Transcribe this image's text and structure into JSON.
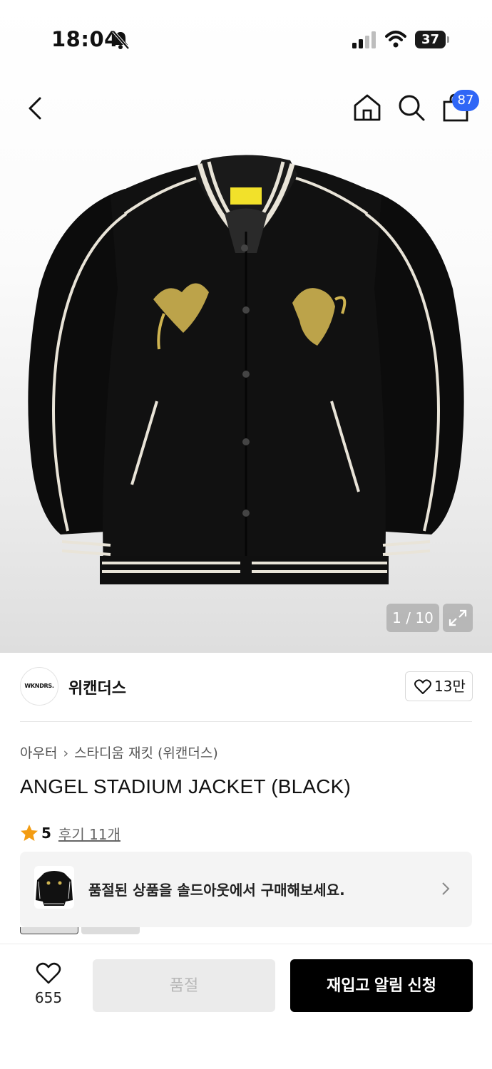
{
  "status_bar": {
    "time": "18:04",
    "battery": "37",
    "icons": [
      "bell-slash-icon",
      "cellular-signal-icon",
      "wifi-icon",
      "battery-icon"
    ]
  },
  "nav": {
    "icons": [
      "chevron-left-icon",
      "home-icon",
      "search-icon",
      "shopping-bag-icon"
    ],
    "cart_badge": "87"
  },
  "gallery": {
    "counter": "1 / 10",
    "expand_icon": "expand-icon"
  },
  "brand": {
    "logo_text": "WKNDRS.",
    "name": "위캔더스",
    "likes": "13만"
  },
  "product": {
    "breadcrumb": [
      "아우터",
      "스타디움 재킷 (위캔더스)"
    ],
    "title": "ANGEL STADIUM JACKET (BLACK)",
    "rating": "5",
    "reviews": "후기 11개"
  },
  "soldout_card": {
    "text": "품절된 상품을 솔드아웃에서 구매해보세요."
  },
  "bottom_bar": {
    "wish_count": "655",
    "soldout_label": "품절",
    "restock_label": "재입고 알림 신청"
  },
  "colors": {
    "badge": "#2f66f6",
    "star": "#f39c12",
    "primary_button": "#000000",
    "disabled_button": "#ebebeb"
  }
}
